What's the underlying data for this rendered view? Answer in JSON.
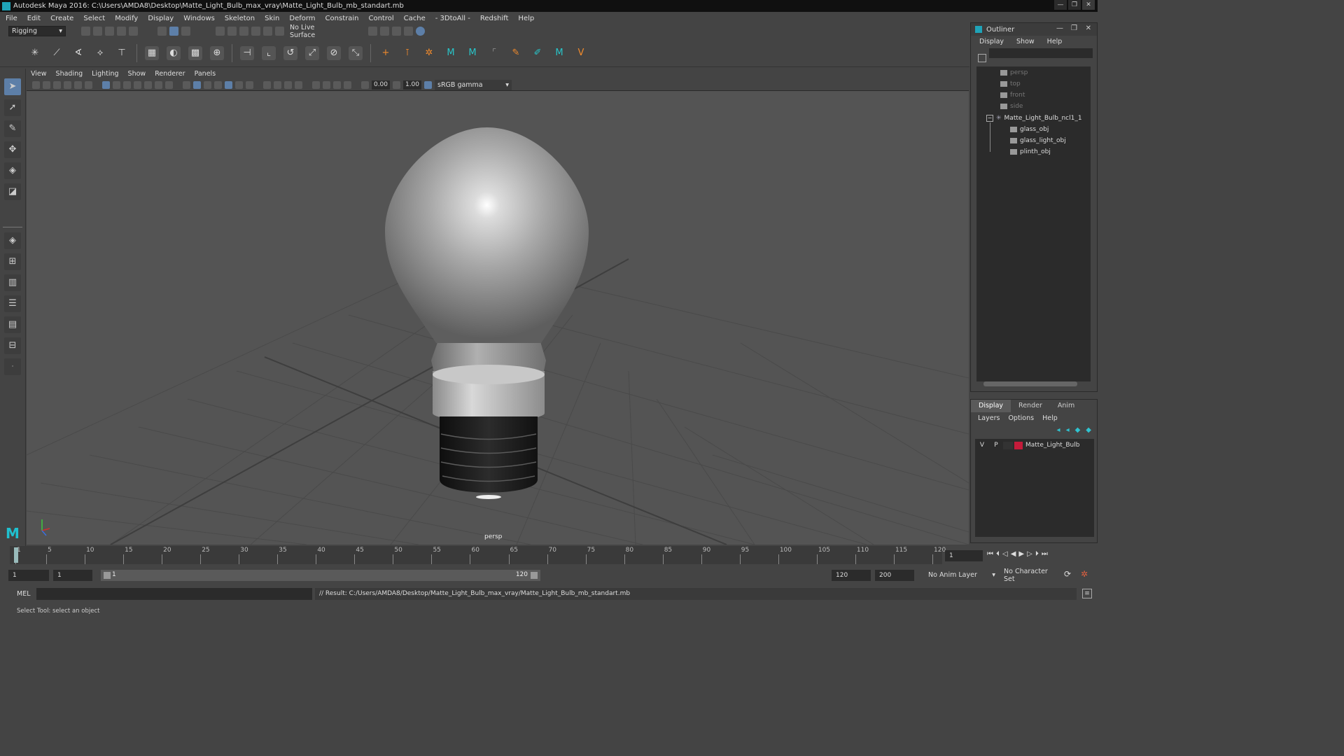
{
  "window": {
    "title": "Autodesk Maya 2016: C:\\Users\\AMDA8\\Desktop\\Matte_Light_Bulb_max_vray\\Matte_Light_Bulb_mb_standart.mb"
  },
  "menubar": {
    "items": [
      "File",
      "Edit",
      "Create",
      "Select",
      "Modify",
      "Display",
      "Windows",
      "Skeleton",
      "Skin",
      "Deform",
      "Constrain",
      "Control",
      "Cache",
      "- 3DtoAll -",
      "Redshift",
      "Help"
    ]
  },
  "toolbar": {
    "mode": "Rigging",
    "live_surface": "No Live Surface"
  },
  "viewport": {
    "menu": [
      "View",
      "Shading",
      "Lighting",
      "Show",
      "Renderer",
      "Panels"
    ],
    "exposure": "0.00",
    "gamma": "1.00",
    "color_space": "sRGB gamma",
    "camera_label": "persp"
  },
  "outliner": {
    "title": "Outliner",
    "menu": [
      "Display",
      "Show",
      "Help"
    ],
    "cameras": [
      "persp",
      "top",
      "front",
      "side"
    ],
    "group": "Matte_Light_Bulb_ncl1_1",
    "children": [
      "glass_obj",
      "glass_light_obj",
      "plinth_obj"
    ]
  },
  "layers": {
    "tabs": [
      "Display",
      "Render",
      "Anim"
    ],
    "menu": [
      "Layers",
      "Options",
      "Help"
    ],
    "layer": {
      "v": "V",
      "p": "P",
      "name": "Matte_Light_Bulb",
      "color": "#c41b3a"
    }
  },
  "timeline": {
    "ticks": [
      "1",
      "5",
      "10",
      "15",
      "20",
      "25",
      "30",
      "35",
      "40",
      "45",
      "50",
      "55",
      "60",
      "65",
      "70",
      "75",
      "80",
      "85",
      "90",
      "95",
      "100",
      "105",
      "110",
      "115",
      "120"
    ],
    "current_frame": "1"
  },
  "range": {
    "start": "1",
    "start2": "1",
    "slider_start": "1",
    "slider_end": "120",
    "end": "120",
    "max": "200",
    "anim_layer": "No Anim Layer",
    "char_set": "No Character Set"
  },
  "command": {
    "lang": "MEL",
    "result": "// Result: C:/Users/AMDA8/Desktop/Matte_Light_Bulb_max_vray/Matte_Light_Bulb_mb_standart.mb"
  },
  "status": {
    "help": "Select Tool: select an object"
  },
  "colors": {
    "accent": "#5d7fa8",
    "viewport_bg": "#545454",
    "panel": "#444444"
  }
}
